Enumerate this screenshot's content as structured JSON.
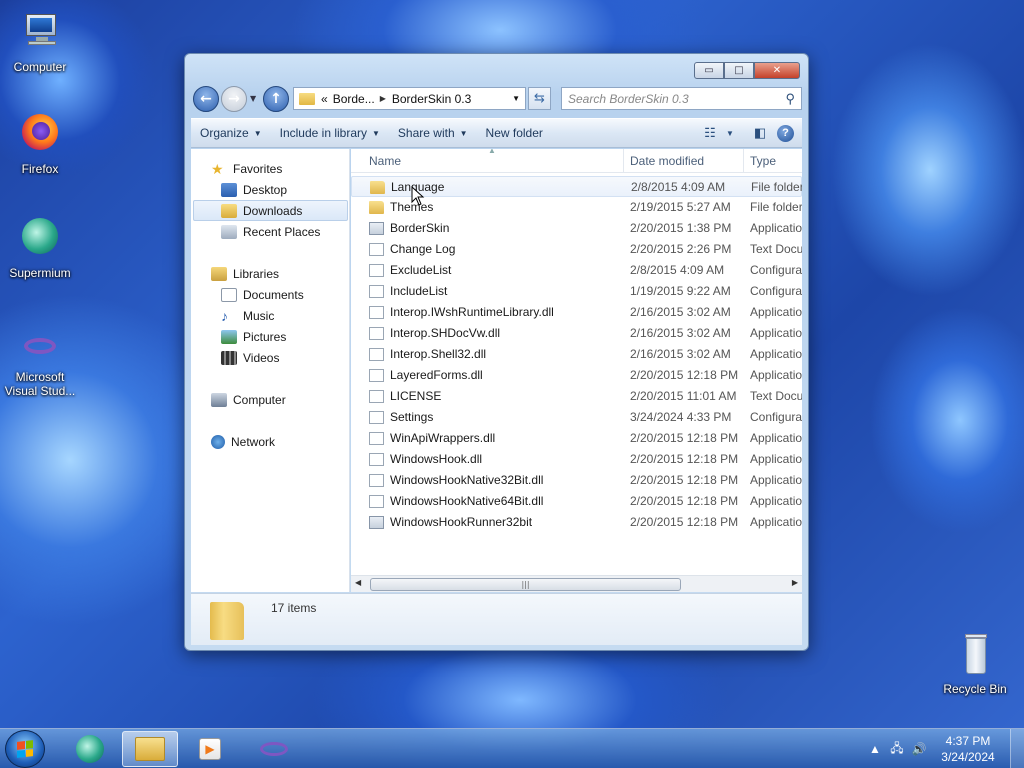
{
  "desktop": {
    "icons": [
      {
        "label": "Computer",
        "icon": "computer-icon"
      },
      {
        "label": "Firefox",
        "icon": "firefox-icon"
      },
      {
        "label": "Supermium",
        "icon": "supermium-icon"
      },
      {
        "label": "Microsoft Visual Stud...",
        "icon": "visual-studio-icon"
      },
      {
        "label": "Recycle Bin",
        "icon": "recycle-bin-icon"
      }
    ]
  },
  "window": {
    "controls": {
      "minimize": "▭",
      "maximize": "□",
      "close": "✕"
    },
    "address": {
      "chevron": "«",
      "segment1": "Borde...",
      "segment2": "BorderSkin 0.3"
    },
    "search_placeholder": "Search BorderSkin 0.3",
    "toolbar": {
      "organize": "Organize",
      "include_in_library": "Include in library",
      "share_with": "Share with",
      "new_folder": "New folder"
    },
    "nav_pane": {
      "favorites": "Favorites",
      "desktop": "Desktop",
      "downloads": "Downloads",
      "recent_places": "Recent Places",
      "libraries": "Libraries",
      "documents": "Documents",
      "music": "Music",
      "pictures": "Pictures",
      "videos": "Videos",
      "computer": "Computer",
      "network": "Network"
    },
    "columns": {
      "name": "Name",
      "date_modified": "Date modified",
      "type": "Type"
    },
    "files": [
      {
        "name": "Language",
        "date": "2/8/2015 4:09 AM",
        "type": "File folder",
        "kind": "folder"
      },
      {
        "name": "Themes",
        "date": "2/19/2015 5:27 AM",
        "type": "File folder",
        "kind": "folder"
      },
      {
        "name": "BorderSkin",
        "date": "2/20/2015 1:38 PM",
        "type": "Application",
        "kind": "app"
      },
      {
        "name": "Change Log",
        "date": "2/20/2015 2:26 PM",
        "type": "Text Document",
        "kind": "file"
      },
      {
        "name": "ExcludeList",
        "date": "2/8/2015 4:09 AM",
        "type": "Configuration",
        "kind": "file"
      },
      {
        "name": "IncludeList",
        "date": "1/19/2015 9:22 AM",
        "type": "Configuration",
        "kind": "file"
      },
      {
        "name": "Interop.IWshRuntimeLibrary.dll",
        "date": "2/16/2015 3:02 AM",
        "type": "Application",
        "kind": "file"
      },
      {
        "name": "Interop.SHDocVw.dll",
        "date": "2/16/2015 3:02 AM",
        "type": "Application",
        "kind": "file"
      },
      {
        "name": "Interop.Shell32.dll",
        "date": "2/16/2015 3:02 AM",
        "type": "Application",
        "kind": "file"
      },
      {
        "name": "LayeredForms.dll",
        "date": "2/20/2015 12:18 PM",
        "type": "Application",
        "kind": "file"
      },
      {
        "name": "LICENSE",
        "date": "2/20/2015 11:01 AM",
        "type": "Text Document",
        "kind": "file"
      },
      {
        "name": "Settings",
        "date": "3/24/2024 4:33 PM",
        "type": "Configuration",
        "kind": "file"
      },
      {
        "name": "WinApiWrappers.dll",
        "date": "2/20/2015 12:18 PM",
        "type": "Application",
        "kind": "file"
      },
      {
        "name": "WindowsHook.dll",
        "date": "2/20/2015 12:18 PM",
        "type": "Application",
        "kind": "file"
      },
      {
        "name": "WindowsHookNative32Bit.dll",
        "date": "2/20/2015 12:18 PM",
        "type": "Application",
        "kind": "file"
      },
      {
        "name": "WindowsHookNative64Bit.dll",
        "date": "2/20/2015 12:18 PM",
        "type": "Application",
        "kind": "file"
      },
      {
        "name": "WindowsHookRunner32bit",
        "date": "2/20/2015 12:18 PM",
        "type": "Application",
        "kind": "app"
      }
    ],
    "status": {
      "items_count": "17 items"
    }
  },
  "taskbar": {
    "clock_time": "4:37 PM",
    "clock_date": "3/24/2024"
  }
}
